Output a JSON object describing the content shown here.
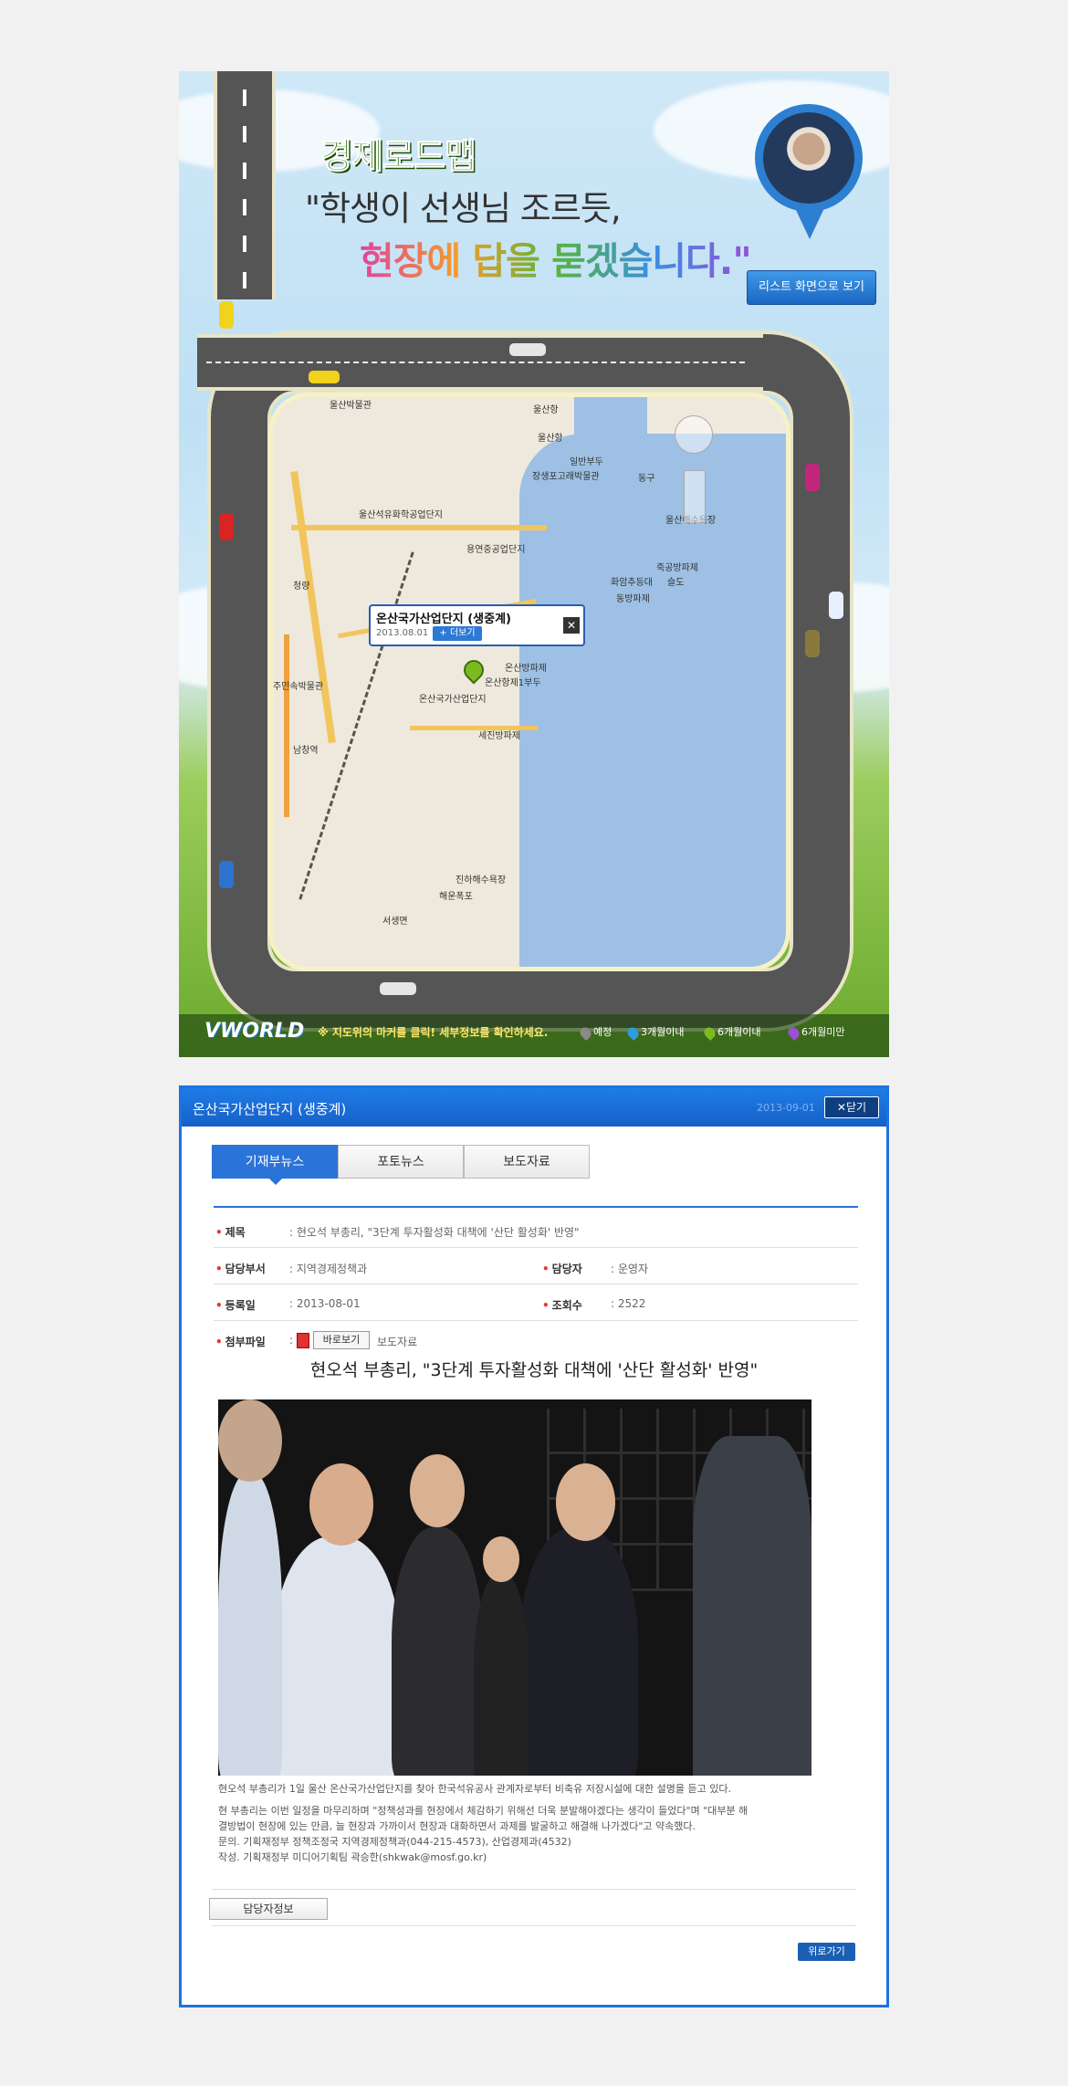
{
  "banner": {
    "logo_text": "경제로드맵",
    "headline_line1": "\"학생이 선생님 조르듯,",
    "headline_line2": "현장에 답을 묻겠습니다.\"",
    "list_view_button": "리스트 화면으로 보기",
    "footer_logo": "VWORLD",
    "footer_notice": "※ 지도위의 마커를 클릭! 세부정보를 확인하세요.",
    "legend": [
      {
        "label": "예정",
        "color": "#8a8a8a"
      },
      {
        "label": "3개월이내",
        "color": "#2f9be0"
      },
      {
        "label": "6개월이내",
        "color": "#7cbb1f"
      },
      {
        "label": "6개월미만",
        "color": "#9b4fd5"
      }
    ],
    "map_labels": {
      "l1": "울산박물관",
      "l2": "울산항",
      "l3": "울산항",
      "l4": "일반부두",
      "l5": "장생포고래박물관",
      "l6": "울산석유화학공업단지",
      "l7": "용연중공업단지",
      "l8": "화암추등대",
      "l9": "동방파제",
      "l10": "울산해수욕장",
      "l11": "주민속박물관",
      "l12": "온산방파제",
      "l13": "온산항제1부두",
      "l14": "온산국가산업단지",
      "l15": "세진방파제",
      "l16": "진하해수욕장",
      "l17": "서생면",
      "l18": "남창역",
      "l19": "해운폭포",
      "l20": "동구",
      "l21": "죽공방파제",
      "l22": "슬도",
      "l23": "청량",
      "l24": "울산항"
    },
    "popup": {
      "title": "온산국가산업단지 (생중계)",
      "date": "2013.08.01",
      "more": "+ 더보기",
      "close": "✕"
    }
  },
  "panel": {
    "title": "온산국가산업단지 (생중계)",
    "date": "2013-09-01",
    "close": "✕닫기",
    "tabs": [
      "기재부뉴스",
      "포토뉴스",
      "보도자료"
    ],
    "fields": {
      "subject_label": "제목",
      "subject_value": ": 현오석 부총리, \"3단계 투자활성화 대책에 '산단 활성화' 반영\"",
      "dept_label": "담당부서",
      "dept_value": ": 지역경제정책과",
      "manager_label": "담당자",
      "manager_value": ": 운영자",
      "reg_label": "등록일",
      "reg_value": ": 2013-08-01",
      "views_label": "조회수",
      "views_value": ": 2522",
      "attach_label": "첨부파일",
      "attach_view": "바로보기",
      "attach_name": "보도자료"
    },
    "article_title": "현오석 부총리, \"3단계 투자활성화 대책에 '산단 활성화' 반영\"",
    "caption": "현오석 부총리가 1일 울산 온산국가산업단지를 찾아 한국석유공사 관계자로부터 비축유 저장시설에 대한 설명을 듣고 있다.",
    "body_lines": [
      "현 부총리는 이번 일정을 마무리하며 \"정책성과를 현장에서 체감하기 위해선 더욱 분발해야겠다는 생각이 들었다\"며 \"대부분 해",
      "결방법이 현장에 있는 만큼, 늘 현장과 가까이서 현장과 대화하면서 과제를 발굴하고 해결해 나가겠다\"고 약속했다.",
      "문의. 기획재정부 정책조정국 지역경제정책과(044-215-4573), 산업경제과(4532)",
      "작성. 기획재정부 미디어기획팀 곽승한(shkwak@mosf.go.kr)"
    ],
    "contact_button": "담당자정보",
    "back_button": "위로가기"
  }
}
